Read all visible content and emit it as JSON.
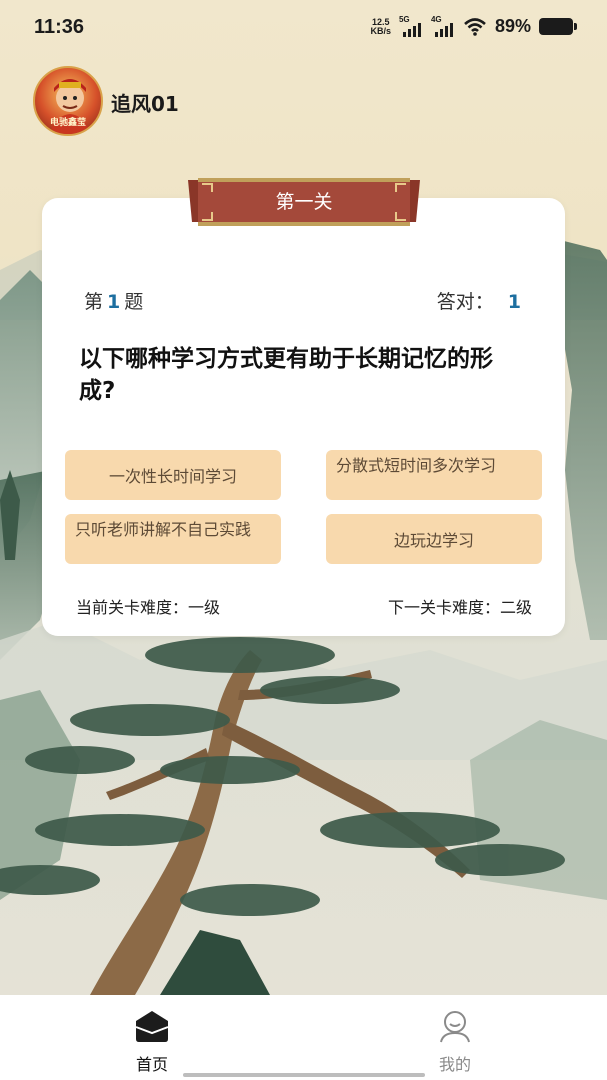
{
  "status_bar": {
    "time": "11:36",
    "net_speed_value": "12.5",
    "net_speed_unit": "KB/s",
    "signal_1": "5G",
    "signal_2": "4G",
    "battery": "89%",
    "icons": [
      "signal-icon",
      "wifi-icon",
      "battery-icon"
    ]
  },
  "user": {
    "name": "追风01",
    "avatar_text": "电驰鑫莹"
  },
  "level": {
    "title": "第一关"
  },
  "quiz": {
    "question_prefix": "第",
    "question_number": "1",
    "question_suffix": "题",
    "correct_label": "答对：",
    "correct_count": "1",
    "question": "以下哪种学习方式更有助于长期记忆的形成?",
    "options": [
      {
        "label": "一次性长时间学习"
      },
      {
        "label": "分散式短时间多次学习"
      },
      {
        "label": "只听老师讲解不自己实践"
      },
      {
        "label": "边玩边学习"
      }
    ],
    "current_difficulty": "当前关卡难度：一级",
    "next_difficulty": "下一关卡难度：二级"
  },
  "nav": {
    "items": [
      {
        "label": "首页",
        "icon": "home-icon",
        "active": true
      },
      {
        "label": "我的",
        "icon": "user-icon",
        "active": false
      }
    ]
  },
  "colors": {
    "accent_blue": "#1d6fa0",
    "option_bg": "#f8d9ad",
    "banner_red": "#a4493a"
  }
}
